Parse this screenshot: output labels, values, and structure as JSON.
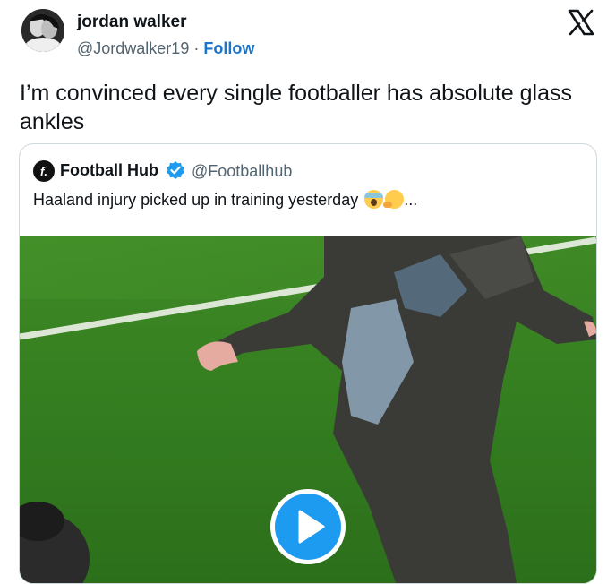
{
  "tweet": {
    "author": {
      "name": "jordan walker",
      "handle": "@Jordwalker19",
      "separator": "·",
      "follow_label": "Follow"
    },
    "logo_icon": "x-logo-icon",
    "text": "I’m convinced every single footballer has absolute glass ankles"
  },
  "quoted_tweet": {
    "author": {
      "name": "Football Hub",
      "handle": "@Footballhub",
      "avatar_glyph": "f.",
      "verified": true
    },
    "text": "Haaland injury picked up in training yesterday",
    "emojis": [
      "face-screaming-in-fear",
      "thinking-face"
    ],
    "ellipsis": "...",
    "media": {
      "type": "video",
      "play_icon": "play-icon"
    }
  },
  "colors": {
    "link": "#1d75c9",
    "verified": "#1d9bf0",
    "secondary_text": "#536471",
    "border": "#cfd9de",
    "play_button": "#1d9bf0"
  }
}
